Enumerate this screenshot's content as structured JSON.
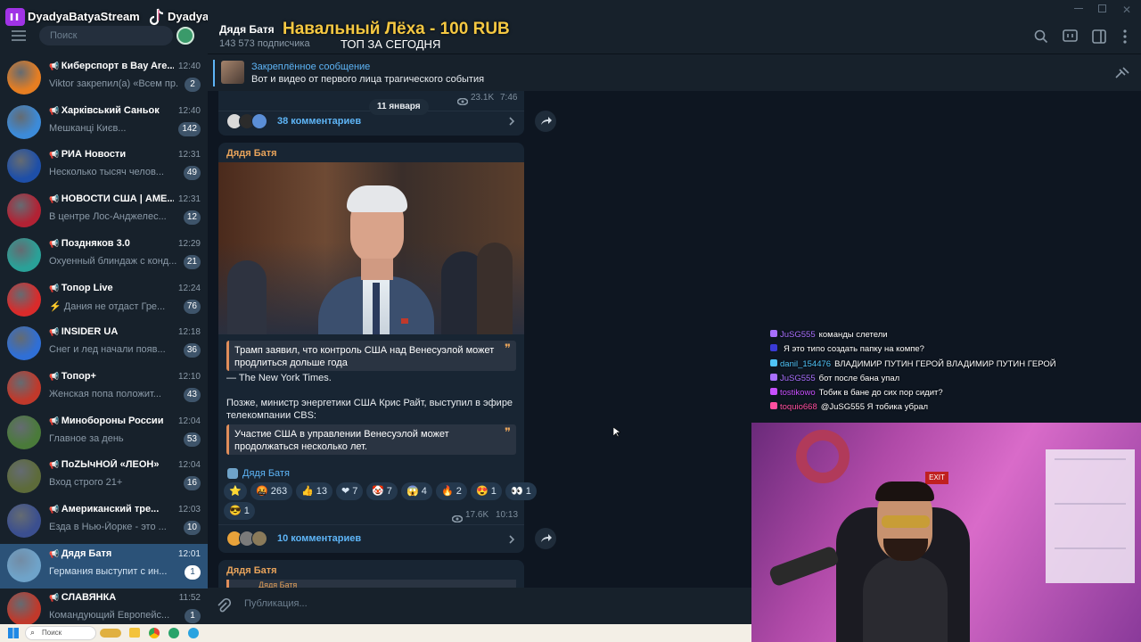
{
  "overlay": {
    "stream_channel": "DyadyaBatyaStream",
    "tiktok_handle": "Dyadya_Batya0",
    "donation_banner": "Навальный Лёха - 100 RUB",
    "donation_sub": "ТОП ЗА СЕГОДНЯ"
  },
  "sidebar": {
    "search_placeholder": "Поиск",
    "chats": [
      {
        "title": "Киберспорт в Bay Are...",
        "time": "12:40",
        "preview": "Viktor закрепил(а) «Всем пр...",
        "badge": "2",
        "color": "#e67e22"
      },
      {
        "title": "Харківський Саньок",
        "time": "12:40",
        "preview": "Мешканці Києв...",
        "badge": "142",
        "color": "#3c8bd9"
      },
      {
        "title": "РИА Новости",
        "time": "12:31",
        "preview": "Несколько тысяч челов...",
        "badge": "49",
        "color": "#1e4fa8"
      },
      {
        "title": "НОВОСТИ США | АМЕ...",
        "time": "12:31",
        "preview": "В центре Лос-Анджелес...",
        "badge": "12",
        "color": "#b22234"
      },
      {
        "title": "Поздняков 3.0",
        "time": "12:29",
        "preview": "Охуенный блиндаж с конд...",
        "badge": "21",
        "color": "#2aa198"
      },
      {
        "title": "Топор Live",
        "time": "12:24",
        "preview": "⚡ Дания не отдаст Гре...",
        "badge": "76",
        "color": "#d92b2b"
      },
      {
        "title": "INSIDER UA",
        "time": "12:18",
        "preview": "Снег и лед начали появ...",
        "badge": "36",
        "color": "#2f6fd6"
      },
      {
        "title": "Топор+",
        "time": "12:10",
        "preview": "Женская попа положит...",
        "badge": "43",
        "color": "#c0392b"
      },
      {
        "title": "Минобороны России",
        "time": "12:04",
        "preview": "Главное за день",
        "badge": "53",
        "color": "#4a7a3a"
      },
      {
        "title": "ПоZЫчНОЙ «ЛЕОН»",
        "time": "12:04",
        "preview": "Вход строго 21+",
        "badge": "16",
        "color": "#5d6b3a"
      },
      {
        "title": "Американский тре...",
        "time": "12:03",
        "preview": "Езда в Нью-Йорке - это ...",
        "badge": "10",
        "color": "#3b4f8f"
      },
      {
        "title": "Дядя Батя",
        "time": "12:01",
        "preview": "Германия выступит с ин...",
        "badge": "1",
        "color": "#6fa3c9"
      },
      {
        "title": "СЛАВЯНКА",
        "time": "11:52",
        "preview": "Командующий Европейс...",
        "badge": "1",
        "color": "#c0392b"
      }
    ]
  },
  "header": {
    "channel_name": "Дядя Батя",
    "subscribers": "143 573 подписчика"
  },
  "pinned": {
    "label": "Закреплённое сообщение",
    "text": "Вот и видео от первого лица трагического события"
  },
  "messages": {
    "prev_views": "23.1K",
    "prev_time": "7:46",
    "date_divider": "11 января",
    "prev_comments": "38 комментариев",
    "post": {
      "author": "Дядя Батя",
      "quote1": "Трамп заявил, что контроль США над Венесуэлой может продлиться дольше года",
      "source": "— The New York Times.",
      "body": "Позже, министр энергетики США Крис Райт, выступил в эфире телекомпании CBS:",
      "quote2": "Участие США в управлении Венесуэлой может продолжаться несколько лет.",
      "signature": "Дядя Батя",
      "reactions": [
        {
          "emoji": "⭐",
          "count": ""
        },
        {
          "emoji": "🤬",
          "count": "263"
        },
        {
          "emoji": "👍",
          "count": "13"
        },
        {
          "emoji": "❤",
          "count": "7"
        },
        {
          "emoji": "🤡",
          "count": "7"
        },
        {
          "emoji": "😱",
          "count": "4"
        },
        {
          "emoji": "🔥",
          "count": "2"
        },
        {
          "emoji": "😍",
          "count": "1"
        },
        {
          "emoji": "👀",
          "count": "1"
        },
        {
          "emoji": "😎",
          "count": "1"
        }
      ],
      "views": "17.6K",
      "time": "10:13",
      "comments": "10 комментариев"
    },
    "next_author": "Дядя Батя",
    "next_quote_author": "Дядя Батя"
  },
  "composer": {
    "placeholder": "Публикация..."
  },
  "taskbar": {
    "search": "Поиск"
  },
  "stream_chat": [
    {
      "user": "JuSG555",
      "msg": "команды слетели",
      "color": "#a970ff"
    },
    {
      "user": "",
      "msg": "Я это типо создать папку на компе?",
      "color": "#3a3ad6"
    },
    {
      "user": "danil_154476",
      "msg": "ВЛАДИМИР ПУТИН ГЕРОЙ ВЛАДИМИР ПУТИН ГЕРОЙ",
      "color": "#4fc3f7"
    },
    {
      "user": "JuSG555",
      "msg": "бот после бана упал",
      "color": "#a970ff"
    },
    {
      "user": "tostikowo",
      "msg": "Тобик в бане до сих пор сидит?",
      "color": "#c850ff"
    },
    {
      "user": "toquio668",
      "msg": "@JuSG555 Я тобика убрал",
      "color": "#ff4fa0"
    }
  ],
  "colors": {
    "accent": "#5eb5f7",
    "author": "#e7a35b",
    "sidebar": "#17212b",
    "active": "#2b5278",
    "banner": "#f5c842"
  }
}
